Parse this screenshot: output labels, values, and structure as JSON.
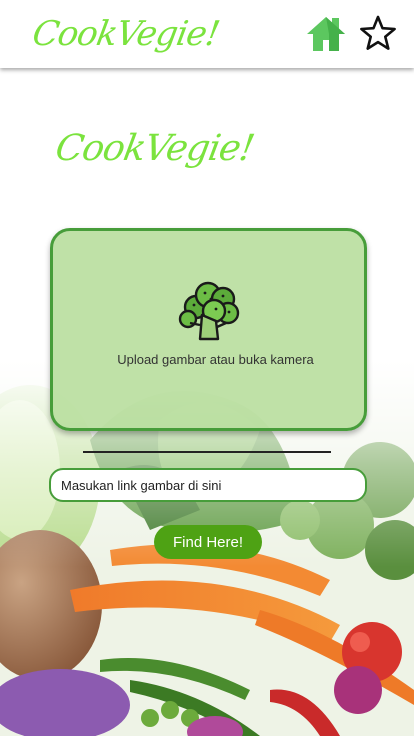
{
  "app": {
    "logo": "CookVegie!"
  },
  "header": {
    "home_icon": "home-icon",
    "favorites_icon": "star-outline-icon"
  },
  "main": {
    "logo": "CookVegie!",
    "upload": {
      "icon": "broccoli-icon",
      "label": "Upload gambar atau buka kamera"
    },
    "link_input": {
      "placeholder": "Masukan link gambar di sini",
      "value": ""
    },
    "find_button": "Find Here!"
  },
  "colors": {
    "brand_green": "#7be33e",
    "card_fill": "#bade a0",
    "card_border": "#479d3a",
    "button_green": "#4ea214",
    "home_icon": "#5cc75f"
  }
}
